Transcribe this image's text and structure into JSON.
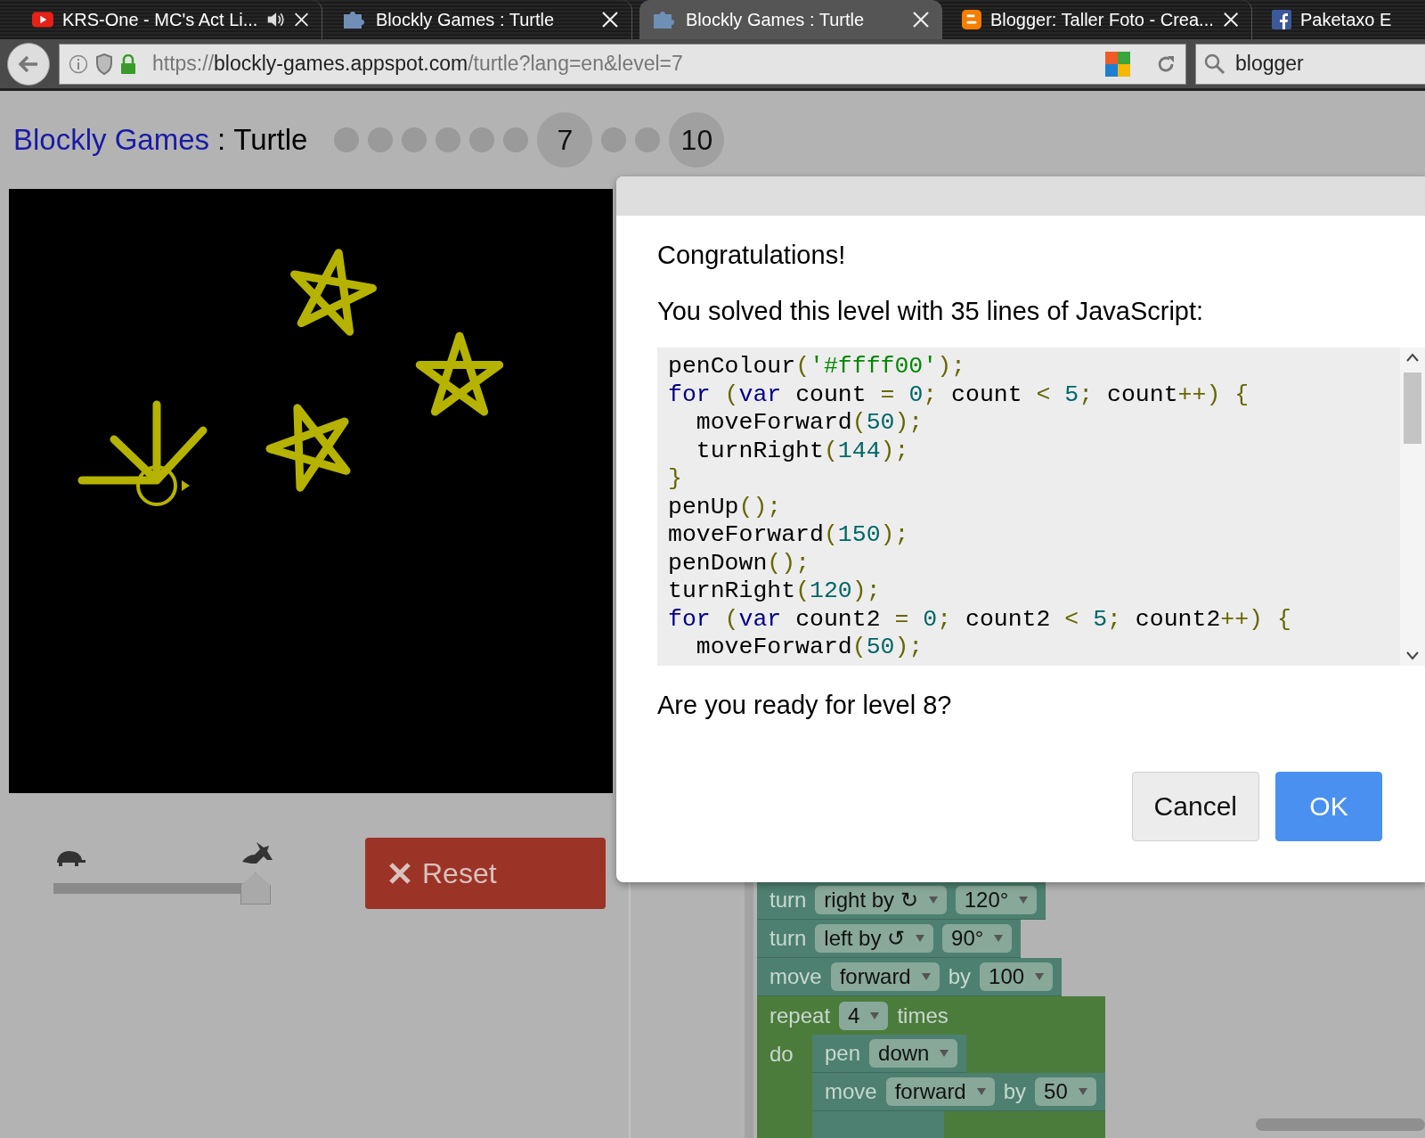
{
  "browser": {
    "tabs": [
      {
        "title": "KRS-One - MC's Act Li...",
        "kind": "video",
        "audio": true,
        "selected": false
      },
      {
        "title": "Blockly Games : Turtle",
        "kind": "game",
        "audio": false,
        "selected": false
      },
      {
        "title": "Blockly Games : Turtle",
        "kind": "game",
        "audio": false,
        "selected": true
      },
      {
        "title": "Blogger: Taller Foto - Crea...",
        "kind": "blog",
        "audio": false,
        "selected": false
      },
      {
        "title": "Paketaxo E",
        "kind": "social",
        "audio": false,
        "selected": false
      }
    ],
    "address": {
      "scheme": "https://",
      "host": "blockly-games.appspot.com",
      "path": "/turtle?lang=en&level=7"
    },
    "search": {
      "value": "blogger"
    }
  },
  "header": {
    "app_name": "Blockly Games",
    "separator": ":",
    "game": "Turtle",
    "levels": [
      {
        "kind": "dot"
      },
      {
        "kind": "dot"
      },
      {
        "kind": "dot"
      },
      {
        "kind": "dot"
      },
      {
        "kind": "dot"
      },
      {
        "kind": "dot"
      },
      {
        "kind": "numbered",
        "label": "7"
      },
      {
        "kind": "dot"
      },
      {
        "kind": "dot"
      },
      {
        "kind": "numbered",
        "label": "10"
      }
    ]
  },
  "speed_slider": {
    "level": 1
  },
  "reset_button": {
    "label": "Reset"
  },
  "dialog": {
    "title": "Congratulations!",
    "message": "You solved this level with 35 lines of JavaScript:",
    "code": [
      [
        {
          "kind": "name",
          "text": "penColour"
        },
        {
          "kind": "punct",
          "text": "("
        },
        {
          "kind": "string",
          "text": "'#ffff00'"
        },
        {
          "kind": "punct",
          "text": ");"
        }
      ],
      [
        {
          "kind": "keyword",
          "text": "for"
        },
        {
          "kind": "punct",
          "text": " ("
        },
        {
          "kind": "keyword",
          "text": "var"
        },
        {
          "kind": "name",
          "text": " count "
        },
        {
          "kind": "punct",
          "text": "= "
        },
        {
          "kind": "number",
          "text": "0"
        },
        {
          "kind": "punct",
          "text": ";"
        },
        {
          "kind": "name",
          "text": " count "
        },
        {
          "kind": "punct",
          "text": "< "
        },
        {
          "kind": "number",
          "text": "5"
        },
        {
          "kind": "punct",
          "text": ";"
        },
        {
          "kind": "name",
          "text": " count"
        },
        {
          "kind": "punct",
          "text": "++) {"
        }
      ],
      [
        {
          "kind": "name",
          "text": "  moveForward"
        },
        {
          "kind": "punct",
          "text": "("
        },
        {
          "kind": "number",
          "text": "50"
        },
        {
          "kind": "punct",
          "text": ");"
        }
      ],
      [
        {
          "kind": "name",
          "text": "  turnRight"
        },
        {
          "kind": "punct",
          "text": "("
        },
        {
          "kind": "number",
          "text": "144"
        },
        {
          "kind": "punct",
          "text": ");"
        }
      ],
      [
        {
          "kind": "punct",
          "text": "}"
        }
      ],
      [
        {
          "kind": "name",
          "text": "penUp"
        },
        {
          "kind": "punct",
          "text": "();"
        }
      ],
      [
        {
          "kind": "name",
          "text": "moveForward"
        },
        {
          "kind": "punct",
          "text": "("
        },
        {
          "kind": "number",
          "text": "150"
        },
        {
          "kind": "punct",
          "text": ");"
        }
      ],
      [
        {
          "kind": "name",
          "text": "penDown"
        },
        {
          "kind": "punct",
          "text": "();"
        }
      ],
      [
        {
          "kind": "name",
          "text": "turnRight"
        },
        {
          "kind": "punct",
          "text": "("
        },
        {
          "kind": "number",
          "text": "120"
        },
        {
          "kind": "punct",
          "text": ");"
        }
      ],
      [
        {
          "kind": "keyword",
          "text": "for"
        },
        {
          "kind": "punct",
          "text": " ("
        },
        {
          "kind": "keyword",
          "text": "var"
        },
        {
          "kind": "name",
          "text": " count2 "
        },
        {
          "kind": "punct",
          "text": "= "
        },
        {
          "kind": "number",
          "text": "0"
        },
        {
          "kind": "punct",
          "text": ";"
        },
        {
          "kind": "name",
          "text": " count2 "
        },
        {
          "kind": "punct",
          "text": "< "
        },
        {
          "kind": "number",
          "text": "5"
        },
        {
          "kind": "punct",
          "text": ";"
        },
        {
          "kind": "name",
          "text": " count2"
        },
        {
          "kind": "punct",
          "text": "++) {"
        }
      ],
      [
        {
          "kind": "name",
          "text": "  moveForward"
        },
        {
          "kind": "punct",
          "text": "("
        },
        {
          "kind": "number",
          "text": "50"
        },
        {
          "kind": "punct",
          "text": ");"
        }
      ]
    ],
    "question": "Are you ready for level 8?",
    "buttons": [
      {
        "label": "Cancel",
        "kind": "secondary"
      },
      {
        "label": "OK",
        "kind": "primary"
      }
    ]
  },
  "workspace": {
    "blocks": [
      {
        "kind": "statement",
        "parts": [
          {
            "kind": "label",
            "text": "turn"
          },
          {
            "kind": "dropdown",
            "text": "right by ↻"
          },
          {
            "kind": "dropdown",
            "text": "120°"
          }
        ]
      },
      {
        "kind": "statement",
        "parts": [
          {
            "kind": "label",
            "text": "turn"
          },
          {
            "kind": "dropdown",
            "text": "left by ↺"
          },
          {
            "kind": "dropdown",
            "text": "90°"
          }
        ]
      },
      {
        "kind": "statement",
        "parts": [
          {
            "kind": "label",
            "text": "move"
          },
          {
            "kind": "dropdown",
            "text": "forward"
          },
          {
            "kind": "label",
            "text": "by"
          },
          {
            "kind": "dropdown",
            "text": "100"
          }
        ]
      },
      {
        "kind": "repeat",
        "parts": [
          {
            "kind": "label",
            "text": "repeat"
          },
          {
            "kind": "dropdown",
            "text": "4"
          },
          {
            "kind": "label",
            "text": "times"
          }
        ],
        "do_label": "do",
        "children": [
          {
            "kind": "statement",
            "parts": [
              {
                "kind": "label",
                "text": "pen"
              },
              {
                "kind": "dropdown",
                "text": "down"
              }
            ]
          },
          {
            "kind": "statement",
            "parts": [
              {
                "kind": "label",
                "text": "move"
              },
              {
                "kind": "dropdown",
                "text": "forward"
              },
              {
                "kind": "label",
                "text": "by"
              },
              {
                "kind": "dropdown",
                "text": "50"
              }
            ]
          }
        ]
      }
    ]
  }
}
